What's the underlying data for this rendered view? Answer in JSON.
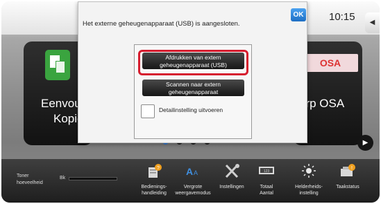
{
  "header": {
    "clock": "10:15",
    "side_tab_icon": "◀"
  },
  "home": {
    "tile_left": {
      "label_line1": "Eenvoud",
      "label_line2": "Kopie",
      "icon": "copy-icon"
    },
    "tile_right": {
      "label": "arp OSA",
      "icon_text": "OSA"
    },
    "page_dots": 4,
    "active_page": 1,
    "next_arrow": "▶"
  },
  "dialog": {
    "message": "Het externe geheugenapparaat (USB) is aangesloten.",
    "ok_label": "OK",
    "print_usb_label": "Afdrukken van extern geheugenapparaat (USB)",
    "scan_usb_label": "Scannen naar extern geheugenapparaat",
    "detail_label": "Detailinstelling uitvoeren",
    "highlight_color": "#d61c2e"
  },
  "bottombar": {
    "toner_label": "Toner hoeveelheid",
    "toner_bk": "Bk",
    "items": [
      {
        "label": "Bedienings-handleiding",
        "icon": "manual-icon"
      },
      {
        "label": "Vergrote weergavemodus",
        "icon": "magnify-text-icon"
      },
      {
        "label": "Instellingen",
        "icon": "settings-tools-icon"
      },
      {
        "label": "Totaal Aantal",
        "icon": "counter-icon"
      },
      {
        "label": "Helderheids-instelling",
        "icon": "brightness-icon"
      },
      {
        "label": "Taakstatus",
        "icon": "job-status-icon"
      }
    ]
  },
  "colors": {
    "accent": "#2b78d8",
    "ok_blue": "#1e6fc4"
  }
}
